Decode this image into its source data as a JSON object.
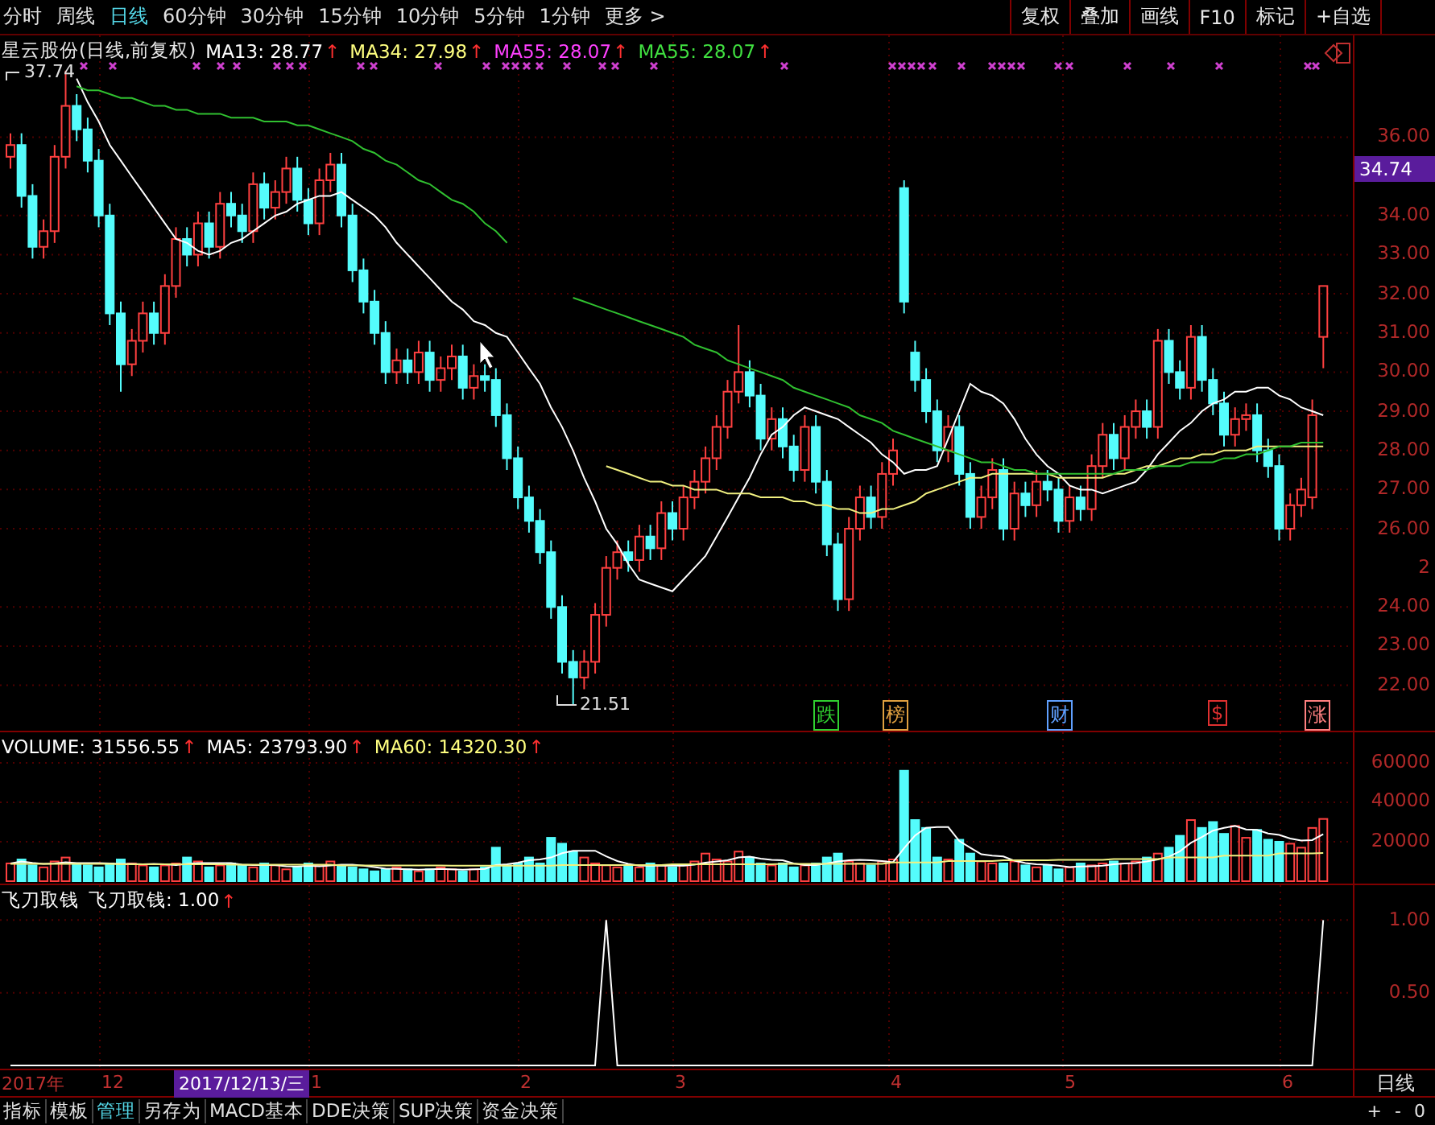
{
  "toolbar": {
    "periods": [
      {
        "label": "分时",
        "selected": false
      },
      {
        "label": "周线",
        "selected": false
      },
      {
        "label": "日线",
        "selected": true
      },
      {
        "label": "60分钟",
        "selected": false
      },
      {
        "label": "30分钟",
        "selected": false
      },
      {
        "label": "15分钟",
        "selected": false
      },
      {
        "label": "10分钟",
        "selected": false
      },
      {
        "label": "5分钟",
        "selected": false
      },
      {
        "label": "1分钟",
        "selected": false
      },
      {
        "label": "更多 >",
        "selected": false
      }
    ],
    "actions": [
      "复权",
      "叠加",
      "画线",
      "F10",
      "标记",
      "+自选"
    ]
  },
  "price_panel": {
    "legend": [
      {
        "label": "星云股份(日线,前复权)",
        "color": "#e8e8e8"
      },
      {
        "label": "MA13: 28.77",
        "arrow": "↑",
        "color": "#ffffff"
      },
      {
        "label": "MA34: 27.98",
        "arrow": "↑",
        "color": "#ffff80"
      },
      {
        "label": "MA55: 28.07",
        "arrow": "↑",
        "color": "#ff40ff"
      },
      {
        "label": "MA55: 28.07",
        "arrow": "↑",
        "color": "#40e040"
      }
    ],
    "chart_data": {
      "type": "candlestick",
      "grid": true,
      "ylim": [
        20.8,
        38.6
      ],
      "yticks": [
        {
          "value": 36,
          "label": "36.00"
        },
        {
          "value": 34,
          "label": "34.00"
        },
        {
          "value": 33,
          "label": "33.00"
        },
        {
          "value": 32,
          "label": "32.00"
        },
        {
          "value": 31,
          "label": "31.00"
        },
        {
          "value": 30,
          "label": "30.00"
        },
        {
          "value": 29,
          "label": "29.00"
        },
        {
          "value": 28,
          "label": "28.00"
        },
        {
          "value": 27,
          "label": "27.00"
        },
        {
          "value": 26,
          "label": "26.00"
        },
        {
          "value": 24,
          "label": "24.00"
        },
        {
          "value": 23,
          "label": "23.00"
        },
        {
          "value": 22,
          "label": "22.00"
        }
      ],
      "ohlc": [
        [
          35.5,
          36.1,
          35.2,
          35.8
        ],
        [
          35.8,
          36.1,
          34.2,
          34.5
        ],
        [
          34.5,
          34.8,
          32.9,
          33.2
        ],
        [
          33.2,
          33.9,
          32.9,
          33.6
        ],
        [
          33.6,
          35.8,
          33.3,
          35.5
        ],
        [
          35.5,
          37.7,
          35.2,
          36.8
        ],
        [
          36.8,
          37.1,
          35.9,
          36.2
        ],
        [
          36.2,
          36.5,
          35.1,
          35.4
        ],
        [
          35.4,
          35.7,
          33.7,
          34.0
        ],
        [
          34.0,
          34.3,
          31.2,
          31.5
        ],
        [
          31.5,
          31.8,
          29.5,
          30.2
        ],
        [
          30.2,
          31.1,
          29.9,
          30.8
        ],
        [
          30.8,
          31.8,
          30.5,
          31.5
        ],
        [
          31.5,
          31.8,
          30.7,
          31.0
        ],
        [
          31.0,
          32.5,
          30.7,
          32.2
        ],
        [
          32.2,
          33.7,
          31.9,
          33.4
        ],
        [
          33.4,
          33.7,
          32.7,
          33.0
        ],
        [
          33.0,
          34.1,
          32.7,
          33.8
        ],
        [
          33.8,
          34.1,
          32.9,
          33.2
        ],
        [
          33.2,
          34.6,
          32.9,
          34.3
        ],
        [
          34.3,
          34.6,
          33.7,
          34.0
        ],
        [
          34.0,
          34.3,
          33.3,
          33.6
        ],
        [
          33.6,
          35.1,
          33.3,
          34.8
        ],
        [
          34.8,
          35.1,
          33.9,
          34.2
        ],
        [
          34.2,
          34.9,
          33.9,
          34.6
        ],
        [
          34.6,
          35.5,
          34.3,
          35.2
        ],
        [
          35.2,
          35.5,
          34.1,
          34.4
        ],
        [
          34.4,
          34.7,
          33.5,
          33.8
        ],
        [
          33.8,
          35.2,
          33.5,
          34.9
        ],
        [
          34.9,
          35.6,
          34.6,
          35.3
        ],
        [
          35.3,
          35.6,
          33.7,
          34.0
        ],
        [
          34.0,
          34.3,
          32.3,
          32.6
        ],
        [
          32.6,
          32.9,
          31.5,
          31.8
        ],
        [
          31.8,
          32.1,
          30.7,
          31.0
        ],
        [
          31.0,
          31.3,
          29.7,
          30.0
        ],
        [
          30.0,
          30.6,
          29.7,
          30.3
        ],
        [
          30.3,
          30.6,
          29.7,
          30.0
        ],
        [
          30.0,
          30.8,
          29.7,
          30.5
        ],
        [
          30.5,
          30.8,
          29.5,
          29.8
        ],
        [
          29.8,
          30.4,
          29.5,
          30.1
        ],
        [
          30.1,
          30.7,
          29.8,
          30.4
        ],
        [
          30.4,
          30.7,
          29.3,
          29.6
        ],
        [
          29.6,
          30.2,
          29.3,
          29.9
        ],
        [
          29.9,
          30.2,
          29.5,
          29.8
        ],
        [
          29.8,
          30.1,
          28.6,
          28.9
        ],
        [
          28.9,
          29.2,
          27.5,
          27.8
        ],
        [
          27.8,
          28.1,
          26.5,
          26.8
        ],
        [
          26.8,
          27.1,
          25.9,
          26.2
        ],
        [
          26.2,
          26.5,
          25.1,
          25.4
        ],
        [
          25.4,
          25.7,
          23.7,
          24.0
        ],
        [
          24.0,
          24.3,
          22.3,
          22.6
        ],
        [
          22.6,
          22.9,
          21.5,
          22.2
        ],
        [
          22.2,
          22.9,
          21.9,
          22.6
        ],
        [
          22.6,
          24.1,
          22.3,
          23.8
        ],
        [
          23.8,
          25.3,
          23.5,
          25.0
        ],
        [
          25.0,
          25.7,
          24.7,
          25.4
        ],
        [
          25.4,
          25.7,
          24.9,
          25.2
        ],
        [
          25.2,
          26.1,
          24.9,
          25.8
        ],
        [
          25.8,
          26.1,
          25.2,
          25.5
        ],
        [
          25.5,
          26.7,
          25.2,
          26.4
        ],
        [
          26.4,
          26.7,
          25.7,
          26.0
        ],
        [
          26.0,
          27.1,
          25.7,
          26.8
        ],
        [
          26.8,
          27.5,
          26.5,
          27.2
        ],
        [
          27.2,
          28.1,
          26.9,
          27.8
        ],
        [
          27.8,
          28.9,
          27.5,
          28.6
        ],
        [
          28.6,
          29.8,
          28.3,
          29.5
        ],
        [
          29.5,
          31.2,
          29.2,
          30.0
        ],
        [
          30.0,
          30.3,
          29.1,
          29.4
        ],
        [
          29.4,
          29.7,
          28.0,
          28.3
        ],
        [
          28.3,
          29.1,
          28.0,
          28.8
        ],
        [
          28.8,
          29.1,
          27.8,
          28.1
        ],
        [
          28.1,
          28.4,
          27.2,
          27.5
        ],
        [
          27.5,
          28.9,
          27.2,
          28.6
        ],
        [
          28.6,
          28.9,
          26.9,
          27.2
        ],
        [
          27.2,
          27.5,
          25.3,
          25.6
        ],
        [
          25.6,
          25.9,
          23.9,
          24.2
        ],
        [
          24.2,
          26.3,
          23.9,
          26.0
        ],
        [
          26.0,
          27.1,
          25.7,
          26.8
        ],
        [
          26.8,
          27.1,
          26.0,
          26.3
        ],
        [
          26.3,
          27.7,
          26.0,
          27.4
        ],
        [
          27.4,
          28.3,
          27.1,
          28.0
        ],
        [
          34.7,
          34.9,
          31.5,
          31.8
        ],
        [
          30.5,
          30.8,
          29.5,
          29.8
        ],
        [
          29.8,
          30.1,
          28.7,
          29.0
        ],
        [
          29.0,
          29.3,
          27.7,
          28.0
        ],
        [
          28.0,
          28.9,
          27.7,
          28.6
        ],
        [
          28.6,
          28.9,
          27.1,
          27.4
        ],
        [
          27.4,
          27.7,
          26.0,
          26.3
        ],
        [
          26.3,
          27.1,
          26.0,
          26.8
        ],
        [
          26.8,
          27.8,
          26.5,
          27.5
        ],
        [
          27.5,
          27.8,
          25.7,
          26.0
        ],
        [
          26.0,
          27.2,
          25.7,
          26.9
        ],
        [
          26.9,
          27.2,
          26.3,
          26.6
        ],
        [
          26.6,
          27.5,
          26.3,
          27.2
        ],
        [
          27.2,
          27.5,
          26.7,
          27.0
        ],
        [
          27.0,
          27.3,
          25.9,
          26.2
        ],
        [
          26.2,
          27.1,
          25.9,
          26.8
        ],
        [
          26.8,
          27.1,
          26.2,
          26.5
        ],
        [
          26.5,
          27.9,
          26.2,
          27.6
        ],
        [
          27.6,
          28.7,
          27.3,
          28.4
        ],
        [
          28.4,
          28.7,
          27.5,
          27.8
        ],
        [
          27.8,
          28.9,
          27.5,
          28.6
        ],
        [
          28.6,
          29.3,
          28.3,
          29.0
        ],
        [
          29.0,
          29.3,
          28.3,
          28.6
        ],
        [
          28.6,
          31.1,
          28.3,
          30.8
        ],
        [
          30.8,
          31.1,
          29.7,
          30.0
        ],
        [
          30.0,
          30.3,
          29.3,
          29.6
        ],
        [
          29.6,
          31.2,
          29.3,
          30.9
        ],
        [
          30.9,
          31.2,
          29.5,
          29.8
        ],
        [
          29.8,
          30.1,
          28.9,
          29.2
        ],
        [
          29.2,
          29.5,
          28.1,
          28.4
        ],
        [
          28.4,
          29.1,
          28.1,
          28.8
        ],
        [
          28.8,
          29.2,
          28.5,
          28.9
        ],
        [
          28.9,
          29.2,
          27.7,
          28.0
        ],
        [
          28.0,
          28.3,
          27.3,
          27.6
        ],
        [
          27.6,
          27.9,
          25.7,
          26.0
        ],
        [
          26.0,
          26.9,
          25.7,
          26.6
        ],
        [
          26.6,
          27.3,
          26.3,
          27.0
        ],
        [
          26.8,
          29.3,
          26.5,
          28.9
        ],
        [
          30.9,
          32.2,
          30.1,
          32.2
        ]
      ],
      "series": [
        {
          "type": "line",
          "color": "#ffffff",
          "values": [
            null,
            null,
            null,
            null,
            null,
            null,
            37.5,
            36.9,
            36.4,
            35.8,
            35.4,
            35.0,
            34.6,
            34.2,
            33.8,
            33.4,
            33.3,
            33.1,
            33.0,
            33.1,
            33.3,
            33.4,
            33.6,
            33.8,
            34.0,
            34.1,
            34.3,
            34.4,
            34.5,
            34.5,
            34.6,
            34.4,
            34.2,
            34.0,
            33.7,
            33.3,
            33.0,
            32.7,
            32.4,
            32.1,
            31.8,
            31.6,
            31.3,
            31.2,
            31.0,
            30.9,
            30.5,
            30.1,
            29.7,
            29.1,
            28.6,
            28.0,
            27.3,
            26.7,
            26.0,
            25.6,
            25.1,
            24.7,
            24.6,
            24.5,
            24.4,
            24.7,
            25.0,
            25.3,
            25.8,
            26.3,
            26.8,
            27.3,
            27.9,
            28.4,
            28.6,
            28.9,
            29.1,
            29.0,
            28.9,
            28.8,
            28.6,
            28.4,
            28.2,
            27.9,
            27.7,
            27.4,
            27.5,
            27.5,
            27.6,
            28.3,
            29.0,
            29.7,
            29.5,
            29.4,
            29.2,
            28.8,
            28.3,
            27.9,
            27.6,
            27.4,
            27.1,
            27.0,
            27.0,
            26.9,
            27.0,
            27.1,
            27.2,
            27.5,
            27.9,
            28.2,
            28.5,
            28.7,
            29.0,
            29.2,
            29.3,
            29.5,
            29.5,
            29.6,
            29.6,
            29.4,
            29.3,
            29.1,
            29.0,
            28.9
          ]
        },
        {
          "type": "line",
          "color": "#f0f080",
          "values": [
            null,
            null,
            null,
            null,
            null,
            null,
            null,
            null,
            null,
            null,
            null,
            null,
            null,
            null,
            null,
            null,
            null,
            null,
            null,
            null,
            null,
            null,
            null,
            null,
            null,
            null,
            null,
            null,
            null,
            null,
            null,
            null,
            null,
            null,
            null,
            null,
            null,
            null,
            null,
            null,
            null,
            null,
            null,
            null,
            null,
            null,
            null,
            null,
            null,
            null,
            null,
            null,
            null,
            null,
            27.6,
            27.5,
            27.4,
            27.3,
            27.2,
            27.2,
            27.1,
            27.1,
            27.0,
            27.0,
            27.0,
            26.9,
            26.9,
            26.9,
            26.8,
            26.8,
            26.8,
            26.7,
            26.7,
            26.6,
            26.6,
            26.5,
            26.5,
            26.4,
            26.4,
            26.5,
            26.5,
            26.6,
            26.7,
            26.9,
            27.0,
            27.1,
            27.2,
            27.3,
            27.3,
            27.4,
            27.4,
            27.4,
            27.4,
            27.4,
            27.4,
            27.3,
            27.3,
            27.3,
            27.3,
            27.3,
            27.4,
            27.4,
            27.5,
            27.6,
            27.6,
            27.7,
            27.8,
            27.8,
            27.9,
            27.9,
            28.0,
            28.0,
            28.0,
            28.1,
            28.1,
            28.1,
            28.1,
            28.1,
            28.1,
            28.1
          ]
        },
        {
          "type": "line",
          "color": "#30c030",
          "values": [
            null,
            null,
            null,
            null,
            null,
            null,
            37.3,
            37.2,
            37.2,
            37.1,
            37.0,
            37.0,
            36.9,
            36.8,
            36.8,
            36.7,
            36.7,
            36.6,
            36.6,
            36.6,
            36.5,
            36.5,
            36.5,
            36.4,
            36.4,
            36.4,
            36.3,
            36.3,
            36.2,
            36.1,
            36.0,
            35.9,
            35.7,
            35.6,
            35.4,
            35.3,
            35.1,
            34.9,
            34.8,
            34.6,
            34.4,
            34.3,
            34.1,
            33.8,
            33.6,
            33.3,
            null,
            null,
            null,
            null,
            null,
            31.9,
            31.8,
            31.7,
            31.6,
            31.5,
            31.4,
            31.3,
            31.2,
            31.1,
            31.0,
            30.9,
            30.7,
            30.6,
            30.5,
            30.3,
            30.2,
            30.1,
            30.0,
            29.9,
            29.8,
            29.6,
            29.5,
            29.4,
            29.3,
            29.2,
            29.1,
            28.9,
            28.8,
            28.7,
            28.5,
            28.4,
            28.3,
            28.2,
            28.1,
            28.0,
            27.9,
            27.8,
            27.7,
            27.7,
            27.6,
            27.5,
            27.5,
            27.4,
            27.4,
            27.4,
            27.4,
            27.4,
            27.4,
            27.4,
            27.4,
            27.5,
            27.5,
            27.5,
            27.6,
            27.6,
            27.6,
            27.7,
            27.7,
            27.7,
            27.8,
            27.8,
            27.9,
            27.9,
            28.0,
            28.1,
            28.1,
            28.2,
            28.2,
            28.2
          ]
        }
      ]
    },
    "cut_tick_label": "2",
    "high_label": "37.74",
    "low_label": "21.51",
    "last_price": "34.74",
    "event_marks": [
      {
        "label": "跌",
        "color": "#30d030"
      },
      {
        "label": "榜",
        "color": "#e0a040"
      },
      {
        "label": "财",
        "color": "#60a0ff"
      },
      {
        "label": "$",
        "color": "#e03030"
      },
      {
        "label": "涨",
        "color": "#ff8080"
      }
    ]
  },
  "volume_panel": {
    "legend": [
      {
        "label": "VOLUME: 31556.55",
        "arrow": "↑",
        "color": "#ffffff"
      },
      {
        "label": "MA5: 23793.90",
        "arrow": "↑",
        "color": "#ffffff"
      },
      {
        "label": "MA60: 14320.30",
        "arrow": "↑",
        "color": "#ffff80"
      }
    ],
    "chart_data": {
      "type": "bar",
      "grid": true,
      "ylim": [
        0,
        75500
      ],
      "yticks": [
        {
          "value": 60000,
          "label": "60000"
        },
        {
          "value": 40000,
          "label": "40000"
        },
        {
          "value": 20000,
          "label": "20000"
        }
      ],
      "series": [
        {
          "type": "bar",
          "colors": [
            "#ff4040",
            "#54fcfc",
            "#54fcfc",
            "#ff4040",
            "#ff4040",
            "#ff4040",
            "#54fcfc",
            "#54fcfc",
            "#54fcfc",
            "#54fcfc",
            "#54fcfc",
            "#ff4040",
            "#ff4040",
            "#54fcfc",
            "#ff4040",
            "#ff4040",
            "#54fcfc",
            "#ff4040",
            "#54fcfc",
            "#ff4040",
            "#54fcfc",
            "#54fcfc",
            "#ff4040",
            "#54fcfc",
            "#ff4040",
            "#ff4040",
            "#54fcfc",
            "#54fcfc",
            "#ff4040",
            "#ff4040",
            "#54fcfc",
            "#54fcfc",
            "#54fcfc",
            "#54fcfc",
            "#54fcfc",
            "#ff4040",
            "#54fcfc",
            "#ff4040",
            "#54fcfc",
            "#ff4040",
            "#ff4040",
            "#54fcfc",
            "#ff4040",
            "#54fcfc",
            "#54fcfc",
            "#54fcfc",
            "#54fcfc",
            "#54fcfc",
            "#54fcfc",
            "#54fcfc",
            "#54fcfc",
            "#54fcfc",
            "#ff4040",
            "#ff4040",
            "#ff4040",
            "#ff4040",
            "#54fcfc",
            "#ff4040",
            "#54fcfc",
            "#ff4040",
            "#54fcfc",
            "#ff4040",
            "#ff4040",
            "#ff4040",
            "#ff4040",
            "#ff4040",
            "#ff4040",
            "#54fcfc",
            "#54fcfc",
            "#ff4040",
            "#54fcfc",
            "#54fcfc",
            "#ff4040",
            "#54fcfc",
            "#54fcfc",
            "#54fcfc",
            "#ff4040",
            "#ff4040",
            "#54fcfc",
            "#ff4040",
            "#ff4040",
            "#54fcfc",
            "#54fcfc",
            "#54fcfc",
            "#54fcfc",
            "#ff4040",
            "#54fcfc",
            "#54fcfc",
            "#ff4040",
            "#ff4040",
            "#54fcfc",
            "#ff4040",
            "#54fcfc",
            "#ff4040",
            "#54fcfc",
            "#54fcfc",
            "#ff4040",
            "#54fcfc",
            "#ff4040",
            "#ff4040",
            "#54fcfc",
            "#ff4040",
            "#ff4040",
            "#54fcfc",
            "#ff4040",
            "#54fcfc",
            "#54fcfc",
            "#ff4040",
            "#54fcfc",
            "#54fcfc",
            "#54fcfc",
            "#ff4040",
            "#ff4040",
            "#54fcfc",
            "#54fcfc",
            "#54fcfc",
            "#ff4040",
            "#ff4040",
            "#ff4040",
            "#ff4040"
          ],
          "values": [
            9000,
            11000,
            8000,
            7000,
            10000,
            12000,
            9000,
            8000,
            7000,
            9000,
            11000,
            9000,
            8000,
            7000,
            8000,
            9000,
            12000,
            10000,
            7000,
            8000,
            9000,
            8000,
            7000,
            9000,
            8000,
            6000,
            7000,
            9000,
            8000,
            10000,
            8000,
            7000,
            6000,
            5000,
            6000,
            7000,
            6000,
            5000,
            6000,
            7000,
            6000,
            5000,
            6000,
            7000,
            17000,
            8000,
            9000,
            12000,
            9000,
            22000,
            19000,
            15000,
            12000,
            9000,
            8000,
            7000,
            8000,
            7000,
            9000,
            8000,
            7000,
            8000,
            10000,
            14000,
            11000,
            10000,
            15000,
            12000,
            9000,
            8000,
            9000,
            7000,
            8000,
            9000,
            12000,
            14000,
            10000,
            9000,
            8000,
            10000,
            11000,
            56000,
            31000,
            27000,
            12000,
            11000,
            21000,
            14000,
            10000,
            9000,
            9000,
            10000,
            8000,
            7000,
            8000,
            6000,
            7000,
            9000,
            8000,
            9000,
            10000,
            9000,
            10000,
            12000,
            14000,
            17000,
            23000,
            31000,
            27000,
            30000,
            24000,
            28000,
            22000,
            26000,
            21000,
            20000,
            19000,
            17000,
            27000,
            31556.55
          ]
        },
        {
          "type": "line",
          "color": "#ffffff",
          "values": [
            9000,
            10000,
            9300,
            8800,
            9000,
            9600,
            9200,
            9200,
            9200,
            9000,
            8800,
            8800,
            8600,
            8800,
            8600,
            8200,
            8800,
            9200,
            9200,
            9200,
            9200,
            8400,
            8200,
            8200,
            8200,
            7600,
            7400,
            7800,
            7600,
            8000,
            8400,
            8400,
            7800,
            7200,
            6400,
            6200,
            6000,
            5800,
            6000,
            6200,
            6000,
            5800,
            6000,
            6200,
            8200,
            8600,
            9400,
            10600,
            11000,
            12000,
            14200,
            15400,
            15400,
            15400,
            12600,
            10200,
            8800,
            7800,
            7800,
            7800,
            7800,
            7800,
            8400,
            9400,
            10000,
            10600,
            12000,
            12400,
            11400,
            10800,
            10600,
            9000,
            8200,
            8200,
            9000,
            10000,
            10600,
            10800,
            10600,
            10200,
            9600,
            16800,
            23200,
            27000,
            27400,
            27400,
            20400,
            17000,
            13600,
            13000,
            12600,
            10400,
            9200,
            8600,
            8400,
            7800,
            7200,
            7400,
            7600,
            7800,
            8600,
            9000,
            9200,
            10000,
            11000,
            12400,
            15200,
            19400,
            22400,
            25600,
            27000,
            28000,
            26200,
            26000,
            24200,
            23400,
            21600,
            20600,
            20800,
            23794
          ]
        },
        {
          "type": "line",
          "color": "#f0f080",
          "values": [
            8800,
            8800,
            8800,
            8800,
            8800,
            8800,
            8800,
            8800,
            8800,
            8800,
            8600,
            8600,
            8600,
            8600,
            8600,
            8600,
            8600,
            8600,
            8600,
            8600,
            8400,
            8400,
            8400,
            8400,
            8400,
            8400,
            8400,
            8400,
            8400,
            8400,
            8000,
            8000,
            8000,
            8000,
            8000,
            8000,
            8000,
            8000,
            8000,
            8000,
            7800,
            7800,
            7800,
            7800,
            7800,
            7800,
            7800,
            7800,
            7800,
            7800,
            8200,
            8200,
            8200,
            8200,
            8200,
            8200,
            8200,
            8200,
            8200,
            8200,
            8600,
            8600,
            8600,
            8600,
            8600,
            8600,
            8600,
            8600,
            8600,
            8600,
            8800,
            8800,
            8800,
            8800,
            8800,
            8800,
            8800,
            8800,
            8800,
            8800,
            9500,
            9500,
            9500,
            9500,
            9500,
            10200,
            10200,
            10200,
            10200,
            10200,
            10600,
            10600,
            10600,
            10600,
            10600,
            10800,
            10800,
            10800,
            10800,
            10800,
            11200,
            11200,
            11200,
            11200,
            11200,
            12000,
            12000,
            12000,
            12000,
            12000,
            13000,
            13000,
            13000,
            13000,
            13000,
            14000,
            14000,
            14000,
            14000,
            14320
          ]
        }
      ]
    }
  },
  "indicator_panel": {
    "legend": [
      {
        "label": "飞刀取钱",
        "color": "#ffffff"
      },
      {
        "label": "飞刀取钱: 1.00",
        "arrow": "↑",
        "color": "#ffffff"
      }
    ],
    "chart_data": {
      "type": "line",
      "grid": true,
      "ylim": [
        0,
        1.24
      ],
      "yticks": [
        {
          "value": 1,
          "label": "1.00"
        },
        {
          "value": 0.5,
          "label": "0.50"
        }
      ],
      "values": [
        0,
        0,
        0,
        0,
        0,
        0,
        0,
        0,
        0,
        0,
        0,
        0,
        0,
        0,
        0,
        0,
        0,
        0,
        0,
        0,
        0,
        0,
        0,
        0,
        0,
        0,
        0,
        0,
        0,
        0,
        0,
        0,
        0,
        0,
        0,
        0,
        0,
        0,
        0,
        0,
        0,
        0,
        0,
        0,
        0,
        0,
        0,
        0,
        0,
        0,
        0,
        0,
        0,
        0,
        1,
        0,
        0,
        0,
        0,
        0,
        0,
        0,
        0,
        0,
        0,
        0,
        0,
        0,
        0,
        0,
        0,
        0,
        0,
        0,
        0,
        0,
        0,
        0,
        0,
        0,
        0,
        0,
        0,
        0,
        0,
        0,
        0,
        0,
        0,
        0,
        0,
        0,
        0,
        0,
        0,
        0,
        0,
        0,
        0,
        0,
        0,
        0,
        0,
        0,
        0,
        0,
        0,
        0,
        0,
        0,
        0,
        0,
        0,
        0,
        0,
        0,
        0,
        0,
        0,
        1
      ]
    }
  },
  "time_axis": {
    "labels": [
      "2017年",
      "12",
      "1",
      "2",
      "3",
      "4",
      "5",
      "6"
    ],
    "cursor_date": "2017/12/13/三",
    "period": "日线"
  },
  "bottom_tabs": [
    {
      "label": "指标",
      "selected": false
    },
    {
      "label": "模板",
      "selected": false
    },
    {
      "label": "管理",
      "selected": true
    },
    {
      "label": "另存为",
      "selected": false
    },
    {
      "label": "MACD基本",
      "selected": false
    },
    {
      "label": "DDE决策",
      "selected": false
    },
    {
      "label": "SUP决策",
      "selected": false
    },
    {
      "label": "资金决策",
      "selected": false
    }
  ],
  "zoom_controls": [
    "+",
    "-",
    "0"
  ]
}
